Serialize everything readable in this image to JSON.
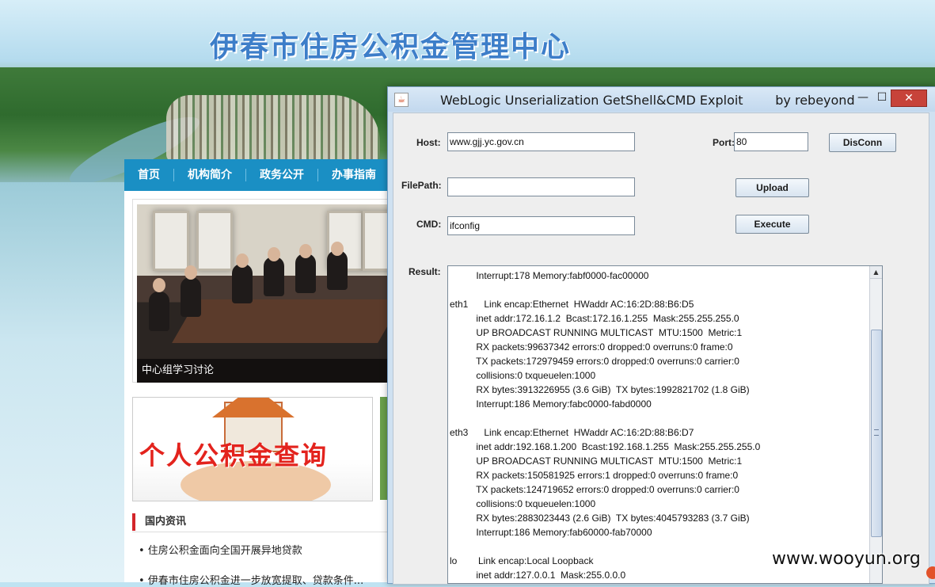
{
  "website": {
    "title": "伊春市住房公积金管理中心",
    "nav": [
      "首页",
      "机构简介",
      "政务公开",
      "办事指南"
    ],
    "photo_caption": "中心组学习讨论",
    "banner_text": "个人公积金查询",
    "news_heading": "国内资讯",
    "news_items": [
      "• 住房公积金面向全国开展异地贷款",
      "• 伊春市住房公积金进一步放宽提取、贷款条件..."
    ]
  },
  "window": {
    "icon": "java-icon",
    "title": "WebLogic Unserialization GetShell&CMD Exploit        by rebeyond",
    "minimize_label": "—",
    "maximize_label": "☐",
    "close_label": "✕"
  },
  "form": {
    "host_label": "Host:",
    "host_value": "www.gjj.yc.gov.cn",
    "port_label": "Port:",
    "port_value": "80",
    "disconn_label": "DisConn",
    "filepath_label": "FilePath:",
    "filepath_value": "",
    "upload_label": "Upload",
    "cmd_label": "CMD:",
    "cmd_value": "ifconfig",
    "execute_label": "Execute",
    "result_label": "Result:"
  },
  "result_text": "          Interrupt:178 Memory:fabf0000-fac00000\n\neth1      Link encap:Ethernet  HWaddr AC:16:2D:88:B6:D5\n          inet addr:172.16.1.2  Bcast:172.16.1.255  Mask:255.255.255.0\n          UP BROADCAST RUNNING MULTICAST  MTU:1500  Metric:1\n          RX packets:99637342 errors:0 dropped:0 overruns:0 frame:0\n          TX packets:172979459 errors:0 dropped:0 overruns:0 carrier:0\n          collisions:0 txqueuelen:1000\n          RX bytes:3913226955 (3.6 GiB)  TX bytes:1992821702 (1.8 GiB)\n          Interrupt:186 Memory:fabc0000-fabd0000\n\neth3      Link encap:Ethernet  HWaddr AC:16:2D:88:B6:D7\n          inet addr:192.168.1.200  Bcast:192.168.1.255  Mask:255.255.255.0\n          UP BROADCAST RUNNING MULTICAST  MTU:1500  Metric:1\n          RX packets:150581925 errors:1 dropped:0 overruns:0 frame:0\n          TX packets:124719652 errors:0 dropped:0 overruns:0 carrier:0\n          collisions:0 txqueuelen:1000\n          RX bytes:2883023443 (2.6 GiB)  TX bytes:4045793283 (3.7 GiB)\n          Interrupt:186 Memory:fab60000-fab70000\n\nlo        Link encap:Local Loopback\n          inet addr:127.0.0.1  Mask:255.0.0.0",
  "watermark": "www.wooyun.org"
}
